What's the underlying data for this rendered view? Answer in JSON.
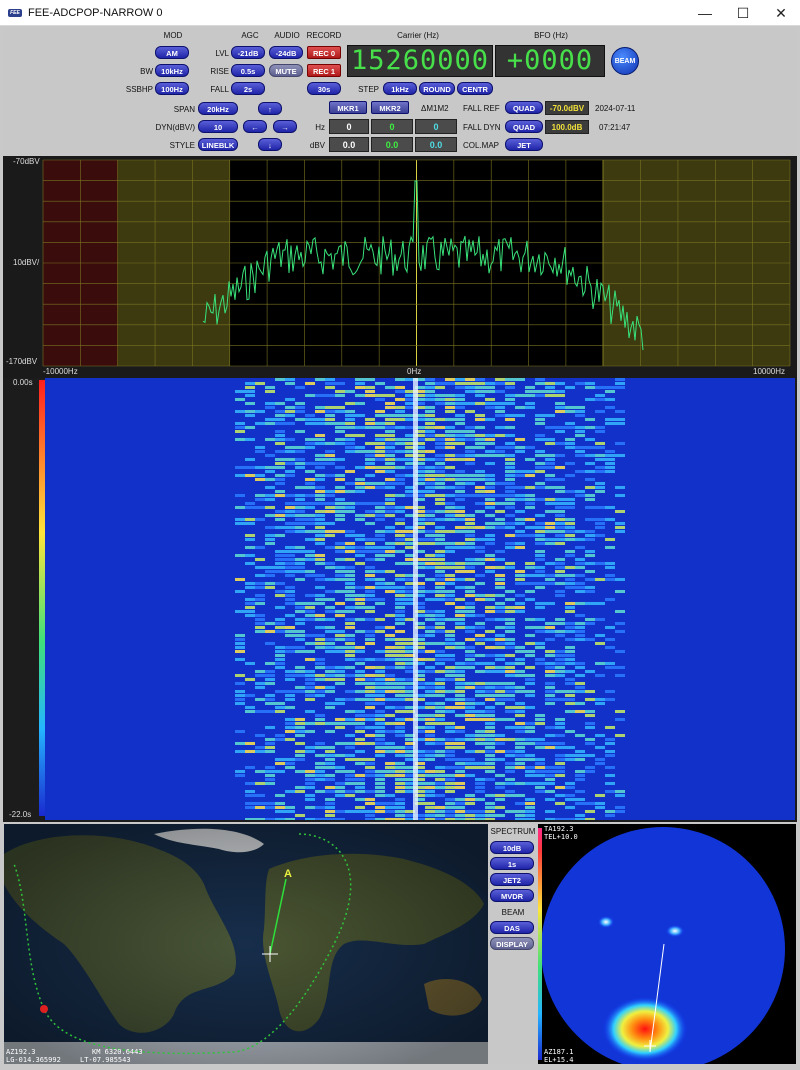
{
  "window": {
    "title": "FEE-ADCPOP-NARROW 0",
    "logo": "FEE",
    "minimize": "—",
    "maximize": "☐",
    "close": "✕"
  },
  "controls": {
    "headers": {
      "mod": "MOD",
      "agc": "AGC",
      "audio": "AUDIO",
      "record": "RECORD",
      "carrier": "Carrier (Hz)",
      "bfo": "BFO (Hz)"
    },
    "mod_value": "AM",
    "bw_label": "BW",
    "bw_value": "10kHz",
    "ssbhp_label": "SSBHP",
    "ssbhp_value": "100Hz",
    "lvl_label": "LVL",
    "lvl_value": "-21dB",
    "rise_label": "RISE",
    "rise_value": "0.5s",
    "fall_label": "FALL",
    "fall_value": "2s",
    "audio_value": "-24dB",
    "mute": "MUTE",
    "rec0": "REC 0",
    "rec1": "REC 1",
    "rec_time": "30s",
    "carrier": "15260000",
    "bfo": "+0000",
    "beam": "BEAM",
    "span_label": "SPAN",
    "span_value": "20kHz",
    "dyn_label": "DYN(dBV/)",
    "dyn_value": "10",
    "style_label": "STYLE",
    "style_value": "LINEBLK",
    "up": "↑",
    "left": "←",
    "right": "→",
    "down": "↓",
    "step_label": "STEP",
    "step_value": "1kHz",
    "round": "ROUND",
    "centr": "CENTR",
    "mkr1": "MKR1",
    "mkr2": "MKR2",
    "delta": "ΔM1M2",
    "hz_label": "Hz",
    "hz_m1": "0",
    "hz_m2": "0",
    "hz_d": "0",
    "dbv_label": "dBV",
    "dbv_m1": "0.0",
    "dbv_m2": "0.0",
    "dbv_d": "0.0",
    "fall_ref_label": "FALL REF",
    "fall_ref_mode": "QUAD",
    "fall_ref_value": "-70.0dBV",
    "fall_dyn_label": "FALL DYN",
    "fall_dyn_mode": "QUAD",
    "fall_dyn_value": "100.0dB",
    "colmap_label": "COL.MAP",
    "colmap_value": "JET",
    "date": "2024-07-11",
    "time": "07:21:47"
  },
  "spectrum": {
    "y_top": "-70dBV",
    "y_mid": "10dBV/",
    "y_bottom": "-170dBV",
    "x_left": "-10000Hz",
    "x_center": "0Hz",
    "x_right": "10000Hz"
  },
  "waterfall": {
    "top_time": "0.00s",
    "bottom_time": "-22.0s"
  },
  "side": {
    "spectrum_label": "SPECTRUM",
    "spec_range": "10dB",
    "spec_time": "1s",
    "spec_map": "JET2",
    "spec_method": "MVDR",
    "beam_label": "BEAM",
    "beam_method": "DAS",
    "display": "DISPLAY"
  },
  "map": {
    "az": "AZ192.3",
    "km": "KM 6320.6443",
    "lg": "LG-014.365992",
    "lt": "LT-07.985543",
    "marker": "A"
  },
  "polar": {
    "ta": "TA192.3",
    "tel": "TEL+10.0",
    "az": "AZ187.1",
    "el": "EL+15.4"
  },
  "colors": {
    "button": "#2a30b8",
    "lcd_text": "#47e04a",
    "grid": "#c9c23a",
    "trace": "#39e27a"
  }
}
